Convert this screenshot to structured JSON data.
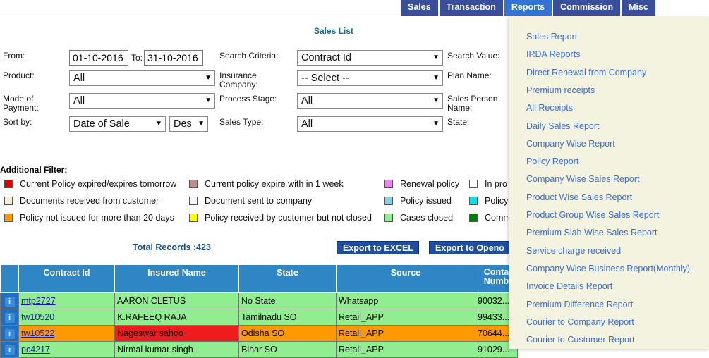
{
  "nav": {
    "items": [
      {
        "label": "Sales",
        "name": "nav-sales",
        "active": false
      },
      {
        "label": "Transaction",
        "name": "nav-transaction",
        "active": false
      },
      {
        "label": "Reports",
        "name": "nav-reports",
        "active": true
      },
      {
        "label": "Commission",
        "name": "nav-commission",
        "active": false
      },
      {
        "label": "Misc",
        "name": "nav-misc",
        "active": false
      }
    ]
  },
  "page_title": "Sales List",
  "form": {
    "from_label": "From:",
    "from_value": "01-10-2016",
    "to_label": "To:",
    "to_value": "31-10-2016",
    "search_criteria_label": "Search Criteria:",
    "search_criteria_value": "Contract Id",
    "search_value_label": "Search Value:",
    "product_label": "Product:",
    "product_value": "All",
    "insurance_company_label": "Insurance Company:",
    "insurance_company_value": "-- Select --",
    "plan_name_label": "Plan Name:",
    "mode_of_payment_label": "Mode of Payment:",
    "mode_of_payment_value": "All",
    "process_stage_label": "Process Stage:",
    "process_stage_value": "All",
    "sales_person_label": "Sales Person Name:",
    "sort_by_label": "Sort by:",
    "sort_by_value": "Date of Sale",
    "sort_order_value": "Des",
    "sales_type_label": "Sales Type:",
    "sales_type_value": "All",
    "state_label": "State:"
  },
  "additional_filter": {
    "title": "Additional Filter:",
    "legend": [
      {
        "label": "Current Policy expired/expires tomorrow",
        "color": "#e00000"
      },
      {
        "label": "Current policy expire with in 1 week",
        "color": "#bc8f8f"
      },
      {
        "label": "Renewal policy",
        "color": "#ee82ee"
      },
      {
        "label": "In pro",
        "color": "#ffffff"
      },
      {
        "label": "Documents received from customer",
        "color": "#faebd7"
      },
      {
        "label": "Document sent to company",
        "color": "#f0f8ff"
      },
      {
        "label": "Policy issued",
        "color": "#87ceeb"
      },
      {
        "label": "Policy",
        "color": "#00e5e5"
      },
      {
        "label": "Policy not issued for more than 20 days",
        "color": "#ff9900"
      },
      {
        "label": "Policy received by customer but not closed",
        "color": "#ffff00"
      },
      {
        "label": "Cases closed",
        "color": "#90ee90"
      },
      {
        "label": "Comm",
        "color": "#008000"
      }
    ]
  },
  "total_records": "Total Records :423",
  "export_excel_label": "Export to EXCEL",
  "export_open_label": "Export to Openo",
  "table": {
    "headers": [
      "",
      "Contract Id",
      "Insured Name",
      "State",
      "Source",
      "Conta Numb"
    ],
    "rows": [
      {
        "id": "mtp2727",
        "name": "AARON CLETUS",
        "state": "No State",
        "source": "Whatsapp",
        "number": "90032...",
        "bg": "#90ee90",
        "name_bg": "#90ee90"
      },
      {
        "id": "tw10520",
        "name": "K.RAFEEQ RAJA",
        "state": "Tamilnadu SO",
        "source": "Retail_APP",
        "number": "99433...",
        "bg": "#90ee90",
        "name_bg": "#90ee90"
      },
      {
        "id": "tw10522",
        "name": "Nageswar sahoo",
        "state": "Odisha SO",
        "source": "Retail_APP",
        "number": "70644...",
        "bg": "#ff9900",
        "name_bg": "#ee1c1c"
      },
      {
        "id": "pc4217",
        "name": "Nirmal kumar singh",
        "state": "Bihar SO",
        "source": "Retail_APP",
        "number": "91029...",
        "bg": "#90ee90",
        "name_bg": "#90ee90"
      }
    ]
  },
  "reports_menu": {
    "items": [
      "Sales Report",
      "IRDA Reports",
      "Direct Renewal from Company",
      "Premium receipts",
      "All Receipts",
      "Daily Sales Report",
      "Company Wise Report",
      "Policy Report",
      "Company Wise Sales Report",
      "Product Wise Sales Report",
      "Product Group Wise Sales Report",
      "Premium Slab Wise Sales Report",
      "Service charge received",
      "Company Wise Business Report(Monthly)",
      "Invoice Details Report",
      "Premium Difference Report",
      "Courier to Company Report",
      "Courier to Customer Report"
    ]
  }
}
